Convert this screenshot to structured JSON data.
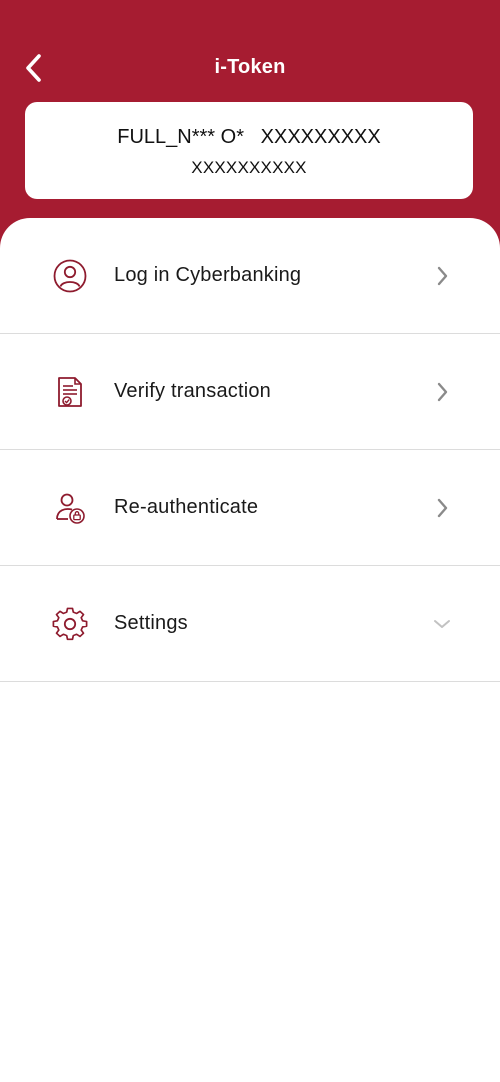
{
  "header": {
    "title": "i-Token",
    "back_icon": "chevron-left-icon"
  },
  "account": {
    "name_line": "FULL_N*** O*   XXXXXXXXX",
    "number_line": "XXXXXXXXXX"
  },
  "menu": {
    "items": [
      {
        "label": "Log in Cyberbanking",
        "icon": "user-circle-icon",
        "chevron": "chevron-right-icon"
      },
      {
        "label": "Verify transaction",
        "icon": "document-check-icon",
        "chevron": "chevron-right-icon"
      },
      {
        "label": "Re-authenticate",
        "icon": "user-lock-icon",
        "chevron": "chevron-right-icon"
      },
      {
        "label": "Settings",
        "icon": "gear-icon",
        "chevron": "chevron-down-icon"
      }
    ]
  },
  "colors": {
    "brand": "#A61C31",
    "icon": "#8E1B2E",
    "chevron": "#8a8a8a",
    "divider": "#dcdcdc"
  }
}
